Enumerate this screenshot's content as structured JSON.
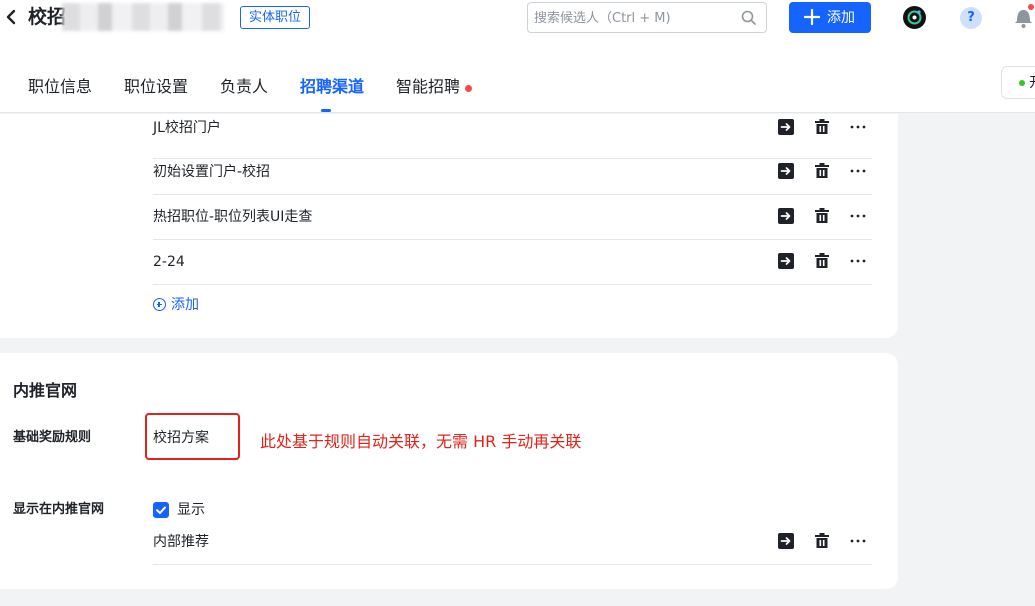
{
  "header": {
    "title": "校招",
    "job_type_tag": "实体职位",
    "search": {
      "placeholder": "搜索候选人（Ctrl + M)"
    },
    "add_button": "添加",
    "help": "?",
    "status_label": "开"
  },
  "tabs": [
    {
      "label": "职位信息",
      "active": false
    },
    {
      "label": "职位设置",
      "active": false
    },
    {
      "label": "负责人",
      "active": false
    },
    {
      "label": "招聘渠道",
      "active": true
    },
    {
      "label": "智能招聘",
      "active": false,
      "has_dot": true
    }
  ],
  "channels": {
    "portals": [
      {
        "name": "JL校招门户"
      },
      {
        "name": "初始设置门户-校招"
      },
      {
        "name": "热招职位-职位列表UI走查"
      },
      {
        "name": "2-24"
      }
    ],
    "add_label": "添加"
  },
  "referral_site": {
    "section_title": "内推官网",
    "reward_rule_label": "基础奖励规则",
    "reward_rule_value": "校招方案",
    "annotation": "此处基于规则自动关联，无需 HR 手动再关联",
    "display_label": "显示在内推官网",
    "display_checkbox_label": "显示",
    "display_checked": true,
    "referral_item": "内部推荐"
  },
  "colors": {
    "accent": "#1664ff",
    "annotation_red": "#e2231a",
    "notification_dot": "#f54a45",
    "status_green": "#34c724"
  }
}
